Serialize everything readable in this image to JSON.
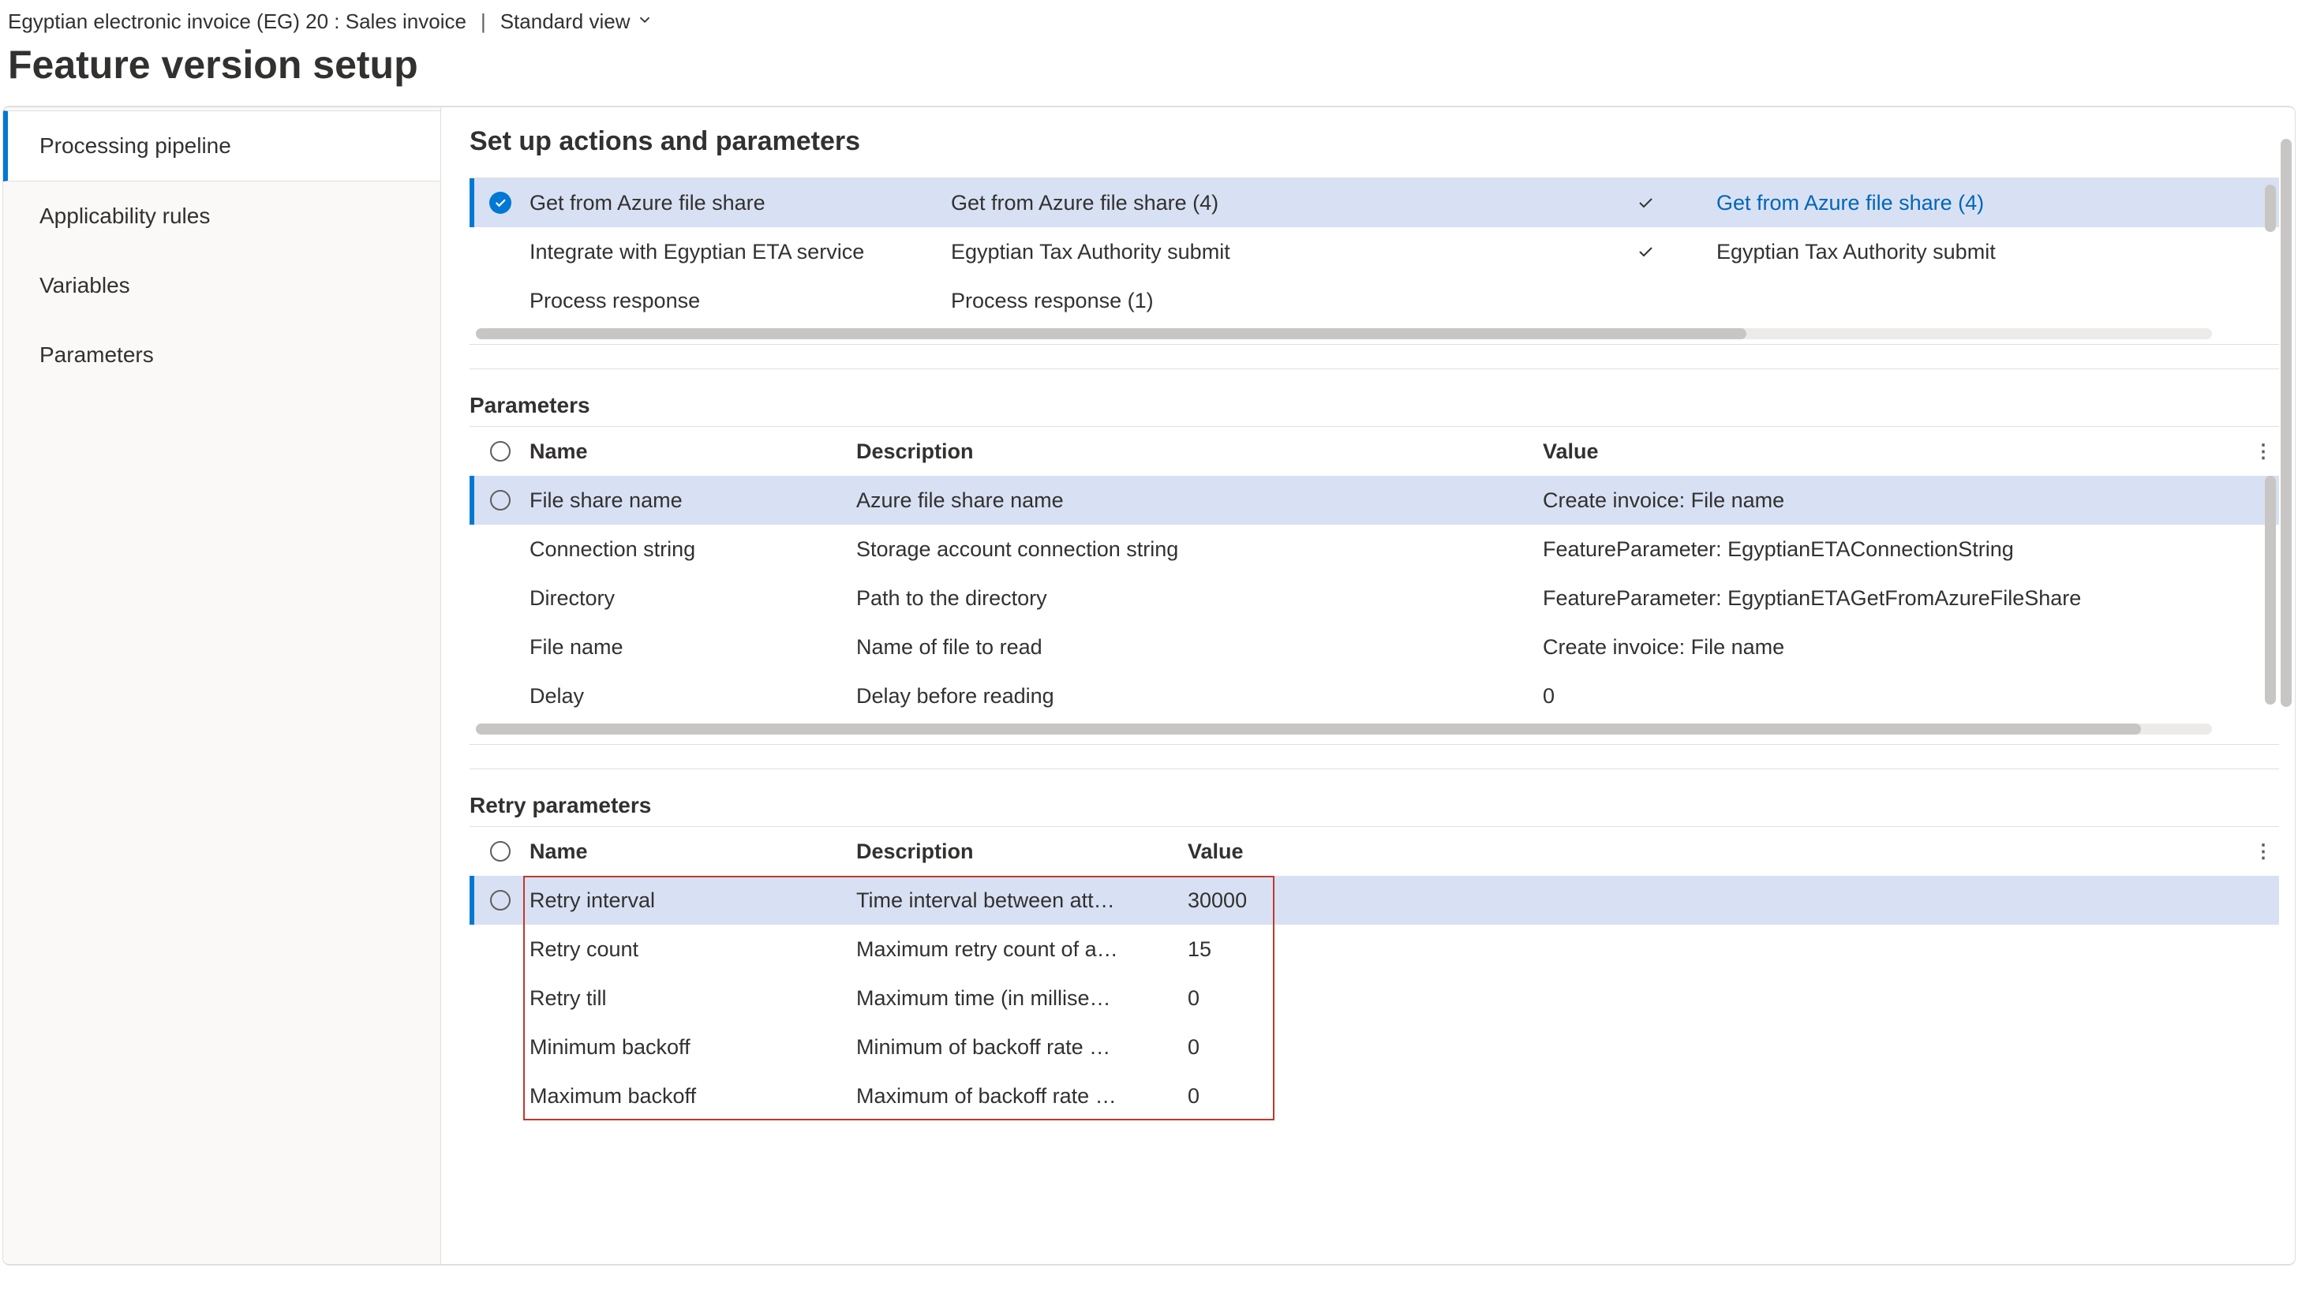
{
  "header": {
    "breadcrumb": "Egyptian electronic invoice (EG) 20 : Sales invoice",
    "view_label": "Standard view"
  },
  "page_title": "Feature version setup",
  "sidebar": {
    "items": [
      {
        "label": "Processing pipeline",
        "active": true
      },
      {
        "label": "Applicability rules",
        "active": false
      },
      {
        "label": "Variables",
        "active": false
      },
      {
        "label": "Parameters",
        "active": false
      }
    ]
  },
  "actions_section": {
    "title": "Set up actions and parameters",
    "rows": [
      {
        "selected": true,
        "name": "Get from Azure file share",
        "detail": "Get from Azure file share (4)",
        "enabled": true,
        "link": "Get from Azure file share (4)"
      },
      {
        "selected": false,
        "name": "Integrate with Egyptian ETA service",
        "detail": "Egyptian Tax Authority submit",
        "enabled": true,
        "link": "Egyptian Tax Authority submit"
      },
      {
        "selected": false,
        "name": "Process response",
        "detail": "Process response (1)",
        "enabled": false,
        "link": ""
      }
    ]
  },
  "parameters_section": {
    "title": "Parameters",
    "headers": {
      "name": "Name",
      "description": "Description",
      "value": "Value"
    },
    "rows": [
      {
        "selected": true,
        "name": "File share name",
        "description": "Azure file share name",
        "value": "Create invoice: File name"
      },
      {
        "selected": false,
        "name": "Connection string",
        "description": "Storage account connection string",
        "value": "FeatureParameter: EgyptianETAConnectionString"
      },
      {
        "selected": false,
        "name": "Directory",
        "description": "Path to the directory",
        "value": "FeatureParameter: EgyptianETAGetFromAzureFileShare"
      },
      {
        "selected": false,
        "name": "File name",
        "description": "Name of file to read",
        "value": "Create invoice: File name"
      },
      {
        "selected": false,
        "name": "Delay",
        "description": "Delay before reading",
        "value": "0"
      }
    ]
  },
  "retry_section": {
    "title": "Retry parameters",
    "headers": {
      "name": "Name",
      "description": "Description",
      "value": "Value"
    },
    "rows": [
      {
        "selected": true,
        "name": "Retry interval",
        "description": "Time interval between att…",
        "value": "30000"
      },
      {
        "selected": false,
        "name": "Retry count",
        "description": "Maximum retry count of a…",
        "value": "15"
      },
      {
        "selected": false,
        "name": "Retry till",
        "description": "Maximum time (in millise…",
        "value": "0"
      },
      {
        "selected": false,
        "name": "Minimum backoff",
        "description": "Minimum of backoff rate …",
        "value": "0"
      },
      {
        "selected": false,
        "name": "Maximum backoff",
        "description": "Maximum of backoff rate …",
        "value": "0"
      }
    ]
  }
}
